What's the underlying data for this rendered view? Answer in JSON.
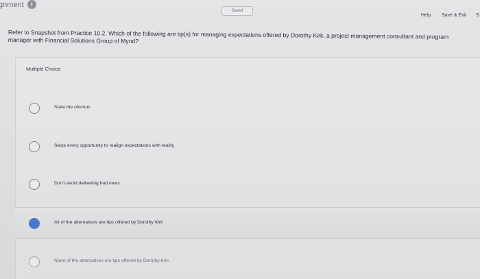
{
  "header": {
    "assignment_title": "gnment",
    "info_icon": "info-icon",
    "saved_status": "Saved",
    "help_label": "Help",
    "save_exit_label": "Save & Exit",
    "submit_cut_label": "S"
  },
  "question": {
    "text": "Refer to Snapshot from Practice 10.2. Which of the following are tip(s) for managing expectations offered by Dorothy Kirk, a project management consultant and program manager with Financial Solutions Group of Mynd?",
    "type_label": "Multiple Choice"
  },
  "choices": [
    {
      "label": "State the obvious",
      "selected": false
    },
    {
      "label": "Seize every opportunity to realign expectations with reality",
      "selected": false
    },
    {
      "label": "Don't avoid delivering bad news",
      "selected": false
    },
    {
      "label": "All of the alternatives are tips offered by Dorothy Kirk",
      "selected": true
    },
    {
      "label": "None of the alternatives are tips offered by Dorothy Kirk",
      "selected": false
    }
  ],
  "colors": {
    "accent": "#4a78c8",
    "background": "#dfe0e2"
  }
}
